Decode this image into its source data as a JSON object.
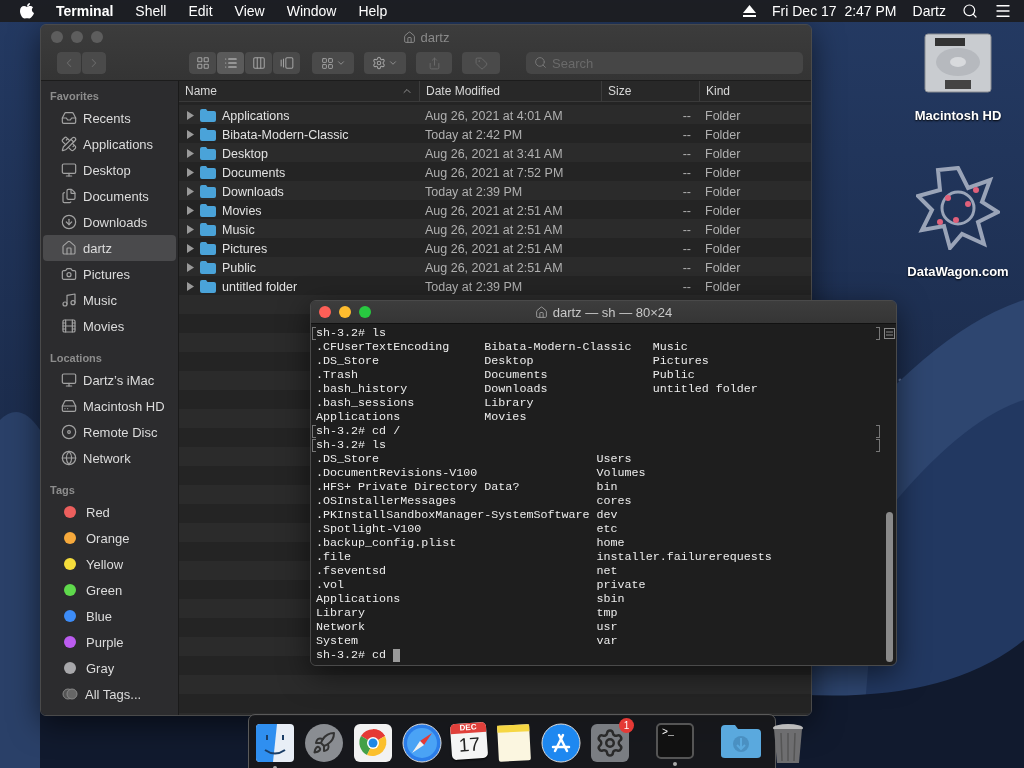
{
  "menu_bar": {
    "app_name": "Terminal",
    "menus": [
      "Shell",
      "Edit",
      "View",
      "Window",
      "Help"
    ],
    "clock": "Fri Dec 17  2:47 PM",
    "user": "Dartz"
  },
  "finder": {
    "title": "dartz",
    "active": false,
    "views": [
      {
        "kind": "icons",
        "selected": false
      },
      {
        "kind": "list",
        "selected": true
      },
      {
        "kind": "columns",
        "selected": false
      },
      {
        "kind": "gallery",
        "selected": false
      }
    ],
    "search": {
      "placeholder": "Search"
    },
    "sidebar": [
      {
        "title": "Favorites",
        "items": [
          {
            "label": "Recents",
            "kind": "recents",
            "selected": false
          },
          {
            "label": "Applications",
            "kind": "applications",
            "selected": false
          },
          {
            "label": "Desktop",
            "kind": "desktop",
            "selected": false
          },
          {
            "label": "Documents",
            "kind": "documents",
            "selected": false
          },
          {
            "label": "Downloads",
            "kind": "downloads",
            "selected": false
          },
          {
            "label": "dartz",
            "kind": "home",
            "selected": true
          },
          {
            "label": "Pictures",
            "kind": "pictures",
            "selected": false
          },
          {
            "label": "Music",
            "kind": "music",
            "selected": false
          },
          {
            "label": "Movies",
            "kind": "movies",
            "selected": false
          }
        ]
      },
      {
        "title": "Locations",
        "items": [
          {
            "label": "Dartz’s iMac",
            "kind": "computer",
            "selected": false
          },
          {
            "label": "Macintosh HD",
            "kind": "drive",
            "selected": false
          },
          {
            "label": "Remote Disc",
            "kind": "disc",
            "selected": false
          },
          {
            "label": "Network",
            "kind": "network",
            "selected": false
          }
        ]
      },
      {
        "title": "Tags",
        "items": [
          {
            "label": "Red",
            "kind": "tag",
            "color": "#ec5f5d",
            "selected": false
          },
          {
            "label": "Orange",
            "kind": "tag",
            "color": "#f6a93c",
            "selected": false
          },
          {
            "label": "Yellow",
            "kind": "tag",
            "color": "#f5dd3b",
            "selected": false
          },
          {
            "label": "Green",
            "kind": "tag",
            "color": "#5fd94c",
            "selected": false
          },
          {
            "label": "Blue",
            "kind": "tag",
            "color": "#3d8cf7",
            "selected": false
          },
          {
            "label": "Purple",
            "kind": "tag",
            "color": "#bc5cf0",
            "selected": false
          },
          {
            "label": "Gray",
            "kind": "tag",
            "color": "#a8a8ab",
            "selected": false
          },
          {
            "label": "All Tags...",
            "kind": "all_tags",
            "selected": false
          }
        ]
      }
    ],
    "columns": [
      {
        "label": "Name",
        "sorted": true
      },
      {
        "label": "Date Modified",
        "sorted": false
      },
      {
        "label": "Size",
        "sorted": false
      },
      {
        "label": "Kind",
        "sorted": false
      }
    ],
    "rows": [
      {
        "name": "Applications",
        "date": "Aug 26, 2021 at 4:01 AM",
        "size": "--",
        "type": "Folder"
      },
      {
        "name": "Bibata-Modern-Classic",
        "date": "Today at 2:42 PM",
        "size": "--",
        "type": "Folder"
      },
      {
        "name": "Desktop",
        "date": "Aug 26, 2021 at 3:41 AM",
        "size": "--",
        "type": "Folder"
      },
      {
        "name": "Documents",
        "date": "Aug 26, 2021 at 7:52 PM",
        "size": "--",
        "type": "Folder"
      },
      {
        "name": "Downloads",
        "date": "Today at 2:39 PM",
        "size": "--",
        "type": "Folder"
      },
      {
        "name": "Movies",
        "date": "Aug 26, 2021 at 2:51 AM",
        "size": "--",
        "type": "Folder"
      },
      {
        "name": "Music",
        "date": "Aug 26, 2021 at 2:51 AM",
        "size": "--",
        "type": "Folder"
      },
      {
        "name": "Pictures",
        "date": "Aug 26, 2021 at 2:51 AM",
        "size": "--",
        "type": "Folder"
      },
      {
        "name": "Public",
        "date": "Aug 26, 2021 at 2:51 AM",
        "size": "--",
        "type": "Folder"
      },
      {
        "name": "untitled folder",
        "date": "Today at 2:39 PM",
        "size": "--",
        "type": "Folder"
      }
    ]
  },
  "terminal": {
    "title": "dartz — sh — 80×24",
    "active": true,
    "blocks": [
      {
        "kind": "prompt",
        "text": "sh-3.2# ls",
        "marked": true,
        "cursor": false
      },
      {
        "kind": "listing",
        "columns": [
          [
            ".CFUserTextEncoding",
            ".DS_Store",
            ".Trash",
            ".bash_history",
            ".bash_sessions",
            "Applications"
          ],
          [
            "Bibata-Modern-Classic",
            "Desktop",
            "Documents",
            "Downloads",
            "Library",
            "Movies"
          ],
          [
            "Music",
            "Pictures",
            "Public",
            "untitled folder"
          ]
        ]
      },
      {
        "kind": "prompt",
        "text": "sh-3.2# cd /",
        "marked": true,
        "cursor": false
      },
      {
        "kind": "prompt",
        "text": "sh-3.2# ls",
        "marked": true,
        "cursor": false
      },
      {
        "kind": "listing",
        "columns": [
          [
            ".DS_Store",
            ".DocumentRevisions-V100",
            ".HFS+ Private Directory Data?",
            ".OSInstallerMessages",
            ".PKInstallSandboxManager-SystemSoftware",
            ".Spotlight-V100",
            ".backup_config.plist",
            ".file",
            ".fseventsd",
            ".vol",
            "Applications",
            "Library",
            "Network",
            "System"
          ],
          [
            "Users",
            "Volumes",
            "bin",
            "cores",
            "dev",
            "etc",
            "home",
            "installer.failurerequests",
            "net",
            "private",
            "sbin",
            "tmp",
            "usr",
            "var"
          ]
        ]
      },
      {
        "kind": "prompt",
        "text": "sh-3.2# cd",
        "marked": false,
        "cursor": true
      }
    ]
  },
  "desktop_icons": [
    {
      "label": "Macintosh HD",
      "kind": "drive"
    },
    {
      "label": "DataWagon.com",
      "kind": "star"
    }
  ],
  "dock": {
    "items": [
      {
        "kind": "finder",
        "running": true
      },
      {
        "kind": "launchpad",
        "running": false
      },
      {
        "kind": "browser",
        "running": false
      },
      {
        "kind": "compass",
        "running": false
      },
      {
        "kind": "calendar",
        "month": "DEC",
        "day": "17",
        "running": false
      },
      {
        "kind": "notes",
        "running": false
      },
      {
        "kind": "appstore",
        "running": false
      },
      {
        "kind": "settings",
        "badge": "1",
        "running": false
      },
      {
        "kind": "separator"
      },
      {
        "kind": "terminal",
        "glyph": ">_",
        "running": true
      },
      {
        "kind": "separator"
      },
      {
        "kind": "downloads",
        "running": false
      },
      {
        "kind": "trash",
        "running": false
      }
    ]
  }
}
